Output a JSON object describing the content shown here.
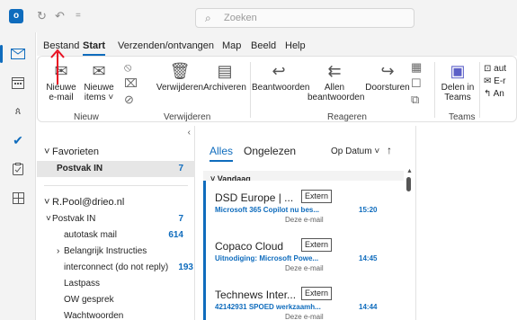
{
  "app": {
    "logo_letter": "o",
    "brand_color": "#0f6cbd"
  },
  "titlebar": {
    "search_placeholder": "Zoeken"
  },
  "menu": {
    "items": [
      "Bestand",
      "Start",
      "Verzenden/ontvangen",
      "Map",
      "Beeld",
      "Help"
    ],
    "selected": "Start"
  },
  "ribbon": {
    "nieuwe_email_line1": "Nieuwe",
    "nieuwe_email_line2": "e-mail",
    "nieuwe_items_line1": "Nieuwe",
    "nieuwe_items_line2": "items",
    "verwijderen": "Verwijderen",
    "archiveren": "Archiveren",
    "beantwoorden": "Beantwoorden",
    "allen_line1": "Allen",
    "allen_line2": "beantwoorden",
    "doorsturen": "Doorsturen",
    "delen_line1": "Delen in",
    "delen_line2": "Teams",
    "right_item1": "aut",
    "right_item2": "E-r",
    "right_item3": "An",
    "group_nieuw": "Nieuw",
    "group_verwijderen": "Verwijderen",
    "group_reageren": "Reageren",
    "group_teams": "Teams"
  },
  "folders": {
    "favorieten": "Favorieten",
    "postvak_in_fav": {
      "label": "Postvak IN",
      "count": "7"
    },
    "account": "R.Pool@drieo.nl",
    "postvak_in": {
      "label": "Postvak IN",
      "count": "7"
    },
    "items": [
      {
        "label": "autotask mail",
        "count": "614"
      },
      {
        "label": "Belangrijk Instructies",
        "count": ""
      },
      {
        "label": "interconnect (do not reply)",
        "count": "193"
      },
      {
        "label": "Lastpass",
        "count": ""
      },
      {
        "label": "OW gesprek",
        "count": ""
      },
      {
        "label": "Wachtwoorden",
        "count": ""
      }
    ]
  },
  "maillist": {
    "tab_all": "Alles",
    "tab_unread": "Ongelezen",
    "sort_label": "Op Datum",
    "group_today": "Vandaag",
    "mails": [
      {
        "sender": "DSD Europe | ...",
        "badge": "Extern",
        "subject": "Microsoft 365 Copilot nu bes...",
        "time": "15:20",
        "preview": "Deze e-mail"
      },
      {
        "sender": "Copaco Cloud",
        "badge": "Extern",
        "subject": "Uitnodiging: Microsoft Powe...",
        "time": "14:45",
        "preview": "Deze e-mail"
      },
      {
        "sender": "Technews Inter...",
        "badge": "Extern",
        "subject": "42142931 SPOED werkzaamh...",
        "time": "14:44",
        "preview": "Deze e-mail"
      }
    ]
  },
  "annotation": {
    "color": "#e81123",
    "icon": "red-up-arrow"
  }
}
